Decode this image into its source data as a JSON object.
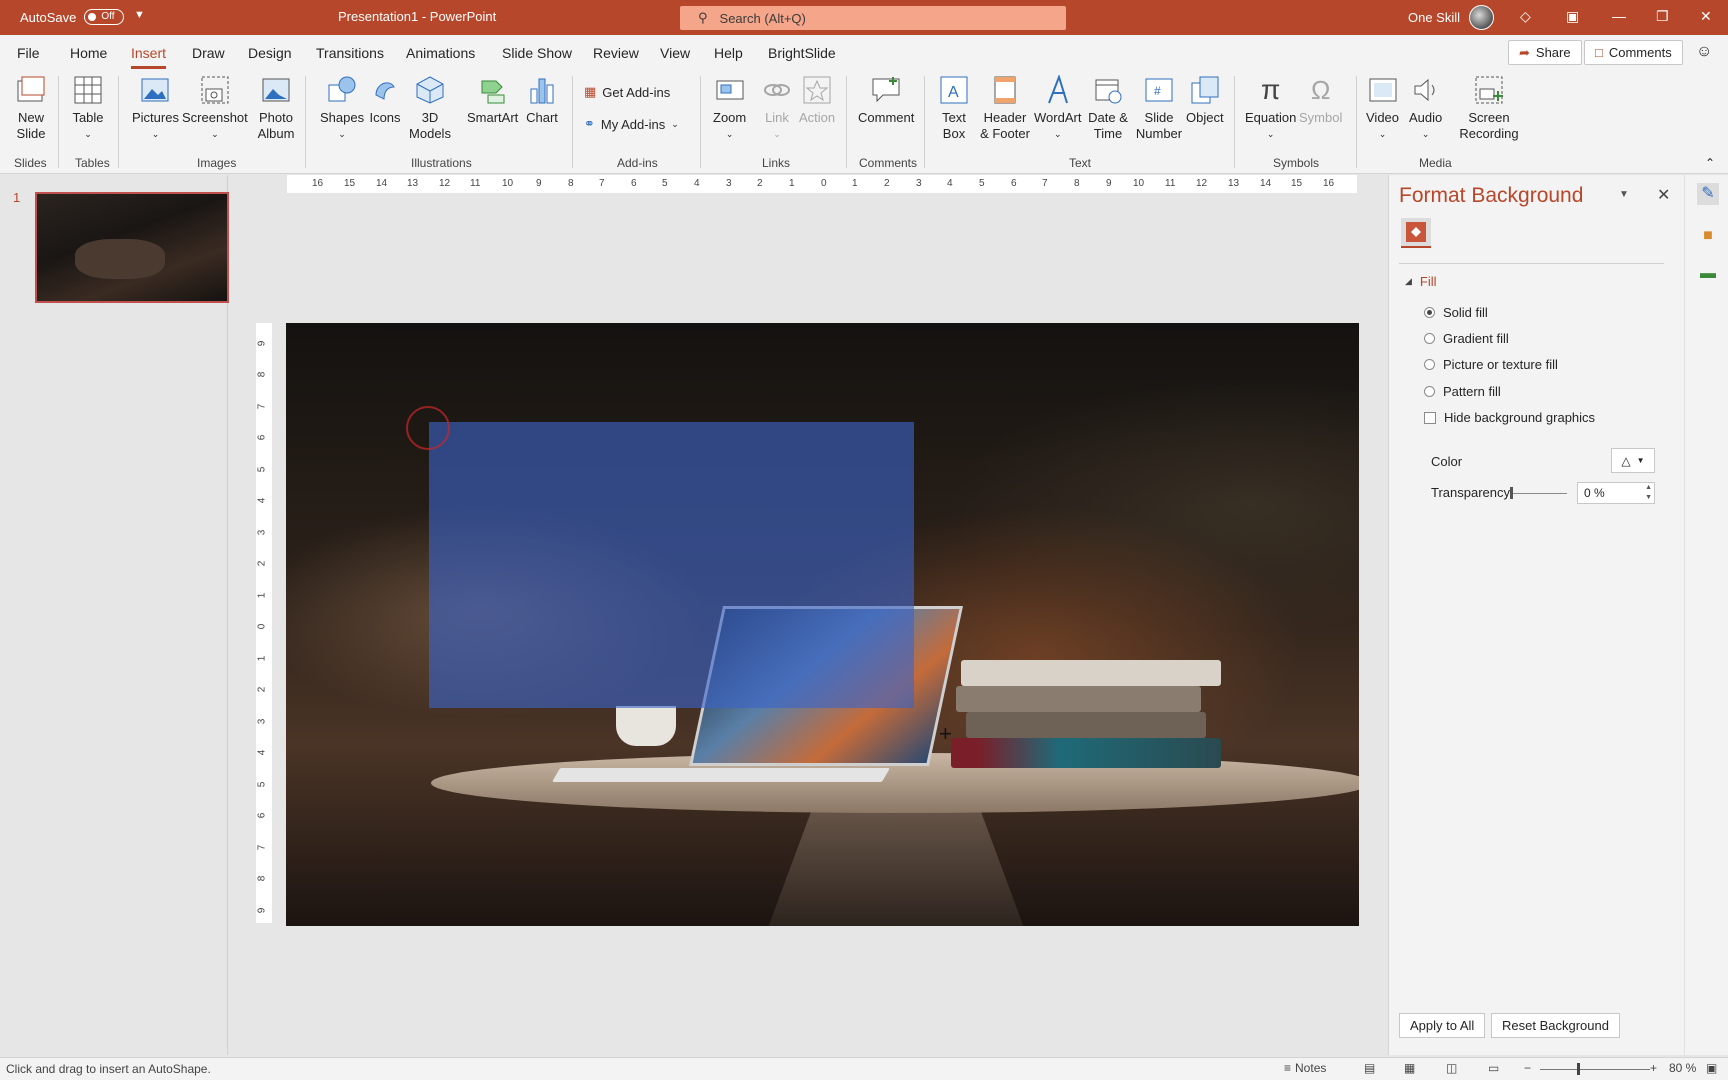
{
  "titlebar": {
    "autosave_label": "AutoSave",
    "autosave_state": "Off",
    "doc_title": "Presentation1  -  PowerPoint",
    "search_placeholder": "Search (Alt+Q)",
    "user_name": "One Skill"
  },
  "tabs": [
    "File",
    "Home",
    "Insert",
    "Draw",
    "Design",
    "Transitions",
    "Animations",
    "Slide Show",
    "Review",
    "View",
    "Help",
    "BrightSlide"
  ],
  "active_tab": "Insert",
  "share_label": "Share",
  "comments_label": "Comments",
  "ribbon": {
    "new_slide": "New Slide",
    "table": "Table",
    "pictures": "Pictures",
    "screenshot": "Screenshot",
    "photo_album": "Photo Album",
    "shapes": "Shapes",
    "icons": "Icons",
    "models_3d": "3D Models",
    "smartart": "SmartArt",
    "chart": "Chart",
    "get_addins": "Get Add-ins",
    "my_addins": "My Add-ins",
    "zoom": "Zoom",
    "link": "Link",
    "action": "Action",
    "comment": "Comment",
    "text_box": "Text Box",
    "header_footer": "Header & Footer",
    "wordart": "WordArt",
    "date_time": "Date & Time",
    "slide_number": "Slide Number",
    "object": "Object",
    "equation": "Equation",
    "symbol": "Symbol",
    "video": "Video",
    "audio": "Audio",
    "screen_recording": "Screen Recording",
    "groups": {
      "slides": "Slides",
      "tables": "Tables",
      "images": "Images",
      "illustrations": "Illustrations",
      "addins": "Add-ins",
      "links": "Links",
      "comments": "Comments",
      "text": "Text",
      "symbols": "Symbols",
      "media": "Media"
    }
  },
  "slide_pane": {
    "slide_number": "1"
  },
  "ruler": {
    "horizontal": [
      "16",
      "15",
      "14",
      "13",
      "12",
      "11",
      "10",
      "9",
      "8",
      "7",
      "6",
      "5",
      "4",
      "3",
      "2",
      "1",
      "0",
      "1",
      "2",
      "3",
      "4",
      "5",
      "6",
      "7",
      "8",
      "9",
      "10",
      "11",
      "12",
      "13",
      "14",
      "15",
      "16"
    ],
    "vertical": [
      "9",
      "8",
      "7",
      "6",
      "5",
      "4",
      "3",
      "2",
      "1",
      "0",
      "1",
      "2",
      "3",
      "4",
      "5",
      "6",
      "7",
      "8",
      "9"
    ]
  },
  "format_background": {
    "title": "Format Background",
    "section_fill": "Fill",
    "options": {
      "solid": "Solid fill",
      "gradient": "Gradient fill",
      "picture": "Picture or texture fill",
      "pattern": "Pattern fill"
    },
    "selected_option": "solid",
    "hide_graphics": "Hide background graphics",
    "color_label": "Color",
    "transparency_label": "Transparency",
    "transparency_value": "0 %",
    "apply_all": "Apply to All",
    "reset": "Reset Background"
  },
  "status": {
    "hint": "Click and drag to insert an AutoShape.",
    "notes": "Notes",
    "zoom": "80 %"
  },
  "colors": {
    "accent": "#b7472a",
    "shape_fill": "#3c64c8"
  }
}
